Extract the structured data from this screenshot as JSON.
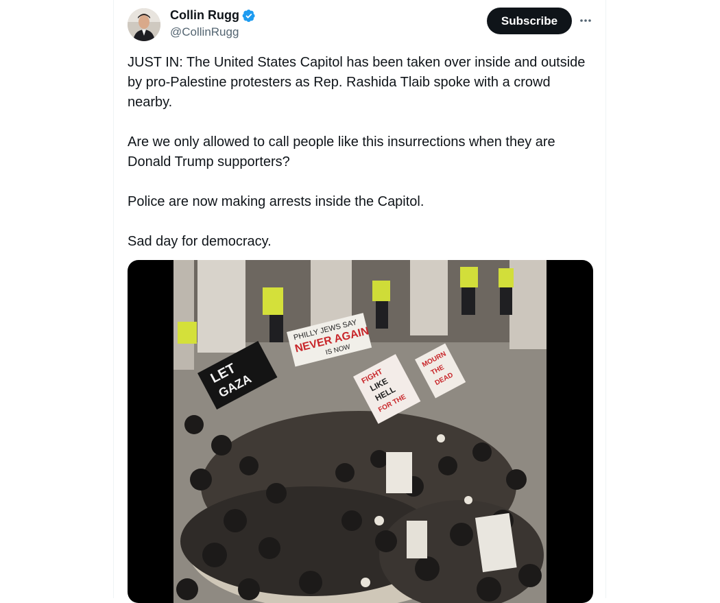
{
  "author": {
    "display_name": "Collin Rugg",
    "handle": "@CollinRugg",
    "verified": true,
    "verified_color": "#1d9bf0"
  },
  "actions": {
    "subscribe_label": "Subscribe",
    "more_icon": "more-horizontal-icon"
  },
  "tweet": {
    "paragraphs": [
      "JUST IN: The United States Capitol has been taken over inside and outside by pro-Palestine protesters as Rep. Rashida Tlaib spoke with a crowd nearby.",
      "Are we only allowed to call people like this insurrections when they are Donald Trump supporters?",
      "Police are now making arrests inside the Capitol.",
      "Sad day for democracy."
    ]
  },
  "media": {
    "banners": {
      "philly": [
        "PHILLY JEWS SAY",
        "NEVER AGAIN",
        "IS NOW"
      ],
      "gaza": [
        "LET",
        "GAZA"
      ],
      "fight": [
        "FIGHT",
        "LIKE",
        "HELL",
        "FOR THE"
      ],
      "mourn": [
        "MOURN",
        "THE",
        "DEAD"
      ]
    }
  },
  "colors": {
    "text": "#0f1419",
    "secondary": "#536471",
    "button": "#0f1419",
    "border": "#eff3f4"
  }
}
